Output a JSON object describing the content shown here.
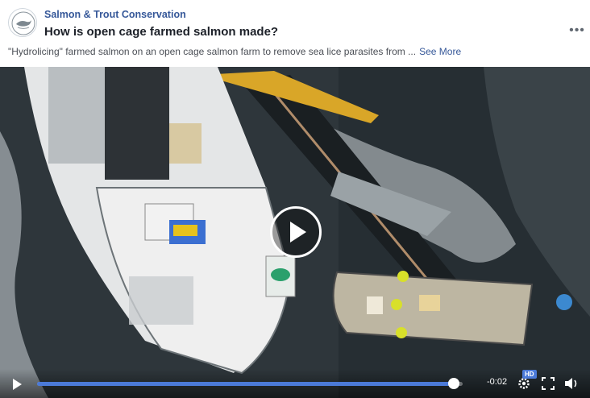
{
  "post": {
    "page_name": "Salmon & Trout Conservation",
    "title": "How is open cage farmed salmon made?",
    "description": "\"Hydrolicing\" farmed salmon on an open cage salmon farm to remove sea lice parasites from ...",
    "see_more": "See More",
    "more_icon": "more-horizontal-icon"
  },
  "video": {
    "progress": 0.98,
    "time_remaining": "-0:02",
    "hd_badge": "HD",
    "icons": [
      "play-icon",
      "settings-icon",
      "fullscreen-icon",
      "volume-icon"
    ],
    "accent_color": "#4b7ad8"
  }
}
